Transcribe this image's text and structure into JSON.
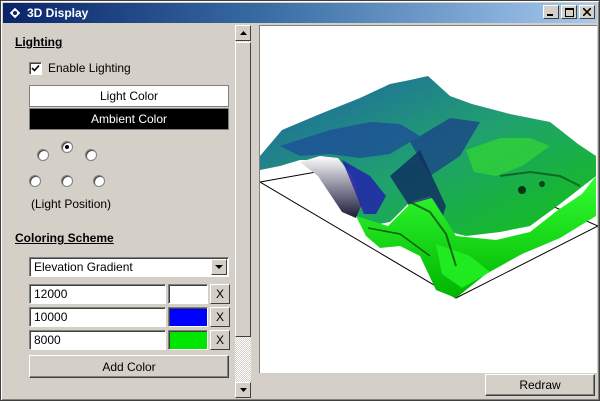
{
  "window": {
    "title": "3D Display",
    "controls": [
      "minimize-icon",
      "maximize-icon",
      "close-icon"
    ]
  },
  "lighting": {
    "section_title": "Lighting",
    "enable_label": "Enable Lighting",
    "enable_checked": true,
    "light_color_label": "Light Color",
    "ambient_color_label": "Ambient Color",
    "light_color": "#ffffff",
    "ambient_color": "#000000",
    "light_position_label": "(Light Position)",
    "selected_position": "top"
  },
  "coloring": {
    "section_title": "Coloring Scheme",
    "scheme": "Elevation Gradient",
    "stops": [
      {
        "value": "12000",
        "color": "#ffffff",
        "remove_label": "X"
      },
      {
        "value": "10000",
        "color": "#0000ff",
        "remove_label": "X"
      },
      {
        "value": "8000",
        "color": "#00e600",
        "remove_label": "X"
      }
    ],
    "add_color_label": "Add Color"
  },
  "actions": {
    "redraw_label": "Redraw"
  },
  "colors": {
    "titlebar_start": "#0a246a",
    "titlebar_end": "#a6caf0",
    "face": "#d4d0c8"
  }
}
